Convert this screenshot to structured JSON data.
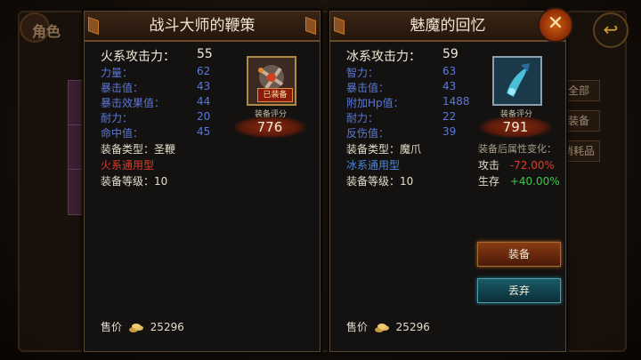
{
  "background": {
    "title": "角色",
    "tabs": [
      "全部",
      "装备",
      "消耗品"
    ]
  },
  "left_item": {
    "name": "战斗大师的鞭策",
    "attack_label": "火系攻击力：",
    "attack_value": "55",
    "stats": [
      {
        "label": "力量：",
        "value": "62"
      },
      {
        "label": "暴击值：",
        "value": "43"
      },
      {
        "label": "暴击效果值：",
        "value": "44"
      },
      {
        "label": "耐力：",
        "value": "20"
      },
      {
        "label": "命中值：",
        "value": "45"
      }
    ],
    "type_line": "装备类型：圣鞭",
    "class_line": "火系通用型",
    "level_line": "装备等级：10",
    "equipped_badge": "已装备",
    "score_label": "装备评分",
    "score": "776",
    "price_label": "售价",
    "price": "25296"
  },
  "right_item": {
    "name": "魅魔的回忆",
    "attack_label": "冰系攻击力：",
    "attack_value": "59",
    "stats": [
      {
        "label": "智力：",
        "value": "63"
      },
      {
        "label": "暴击值：",
        "value": "43"
      },
      {
        "label": "附加Hp值：",
        "value": "1488"
      },
      {
        "label": "耐力：",
        "value": "22"
      },
      {
        "label": "反伤值：",
        "value": "39"
      }
    ],
    "type_line": "装备类型：魔爪",
    "class_line": "冰系通用型",
    "level_line": "装备等级：10",
    "score_label": "装备评分",
    "score": "791",
    "change_title": "装备后属性变化：",
    "changes": [
      {
        "label": "攻击",
        "value": "-72.00%"
      },
      {
        "label": "生存",
        "value": "+40.00%"
      }
    ],
    "price_label": "售价",
    "price": "25296"
  },
  "buttons": {
    "equip": "装备",
    "discard": "丢弃",
    "close": "✕",
    "back": "↩"
  },
  "colors": {
    "stat_blue": "#5a78d8",
    "negative": "#e03a2a",
    "positive": "#3ac84a",
    "class_fire": "#e03a2a",
    "class_ice": "#4a86e0"
  }
}
